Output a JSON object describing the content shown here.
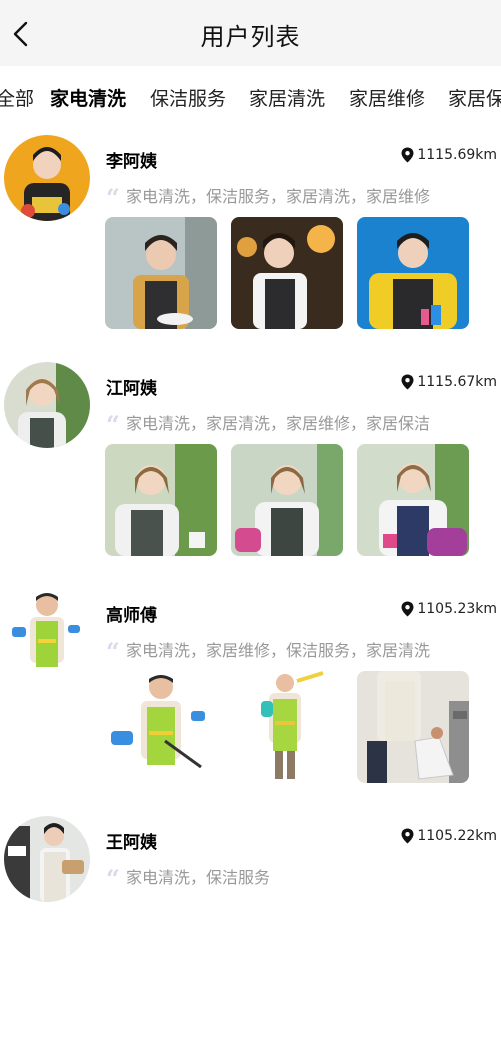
{
  "header": {
    "title": "用户列表",
    "back_icon": "chevron-left-icon"
  },
  "tabs": [
    {
      "label": "全部",
      "active": false
    },
    {
      "label": "家电清洗",
      "active": true
    },
    {
      "label": "保洁服务",
      "active": false
    },
    {
      "label": "家居清洗",
      "active": false
    },
    {
      "label": "家居维修",
      "active": false
    },
    {
      "label": "家居保洁",
      "active": false
    }
  ],
  "workers": [
    {
      "name": "李阿姨",
      "distance": "1115.69km",
      "services": "家电清洗，保洁服务，家居清洗，家居维修"
    },
    {
      "name": "江阿姨",
      "distance": "1115.67km",
      "services": "家电清洗，家居清洗，家居维修，家居保洁"
    },
    {
      "name": "高师傅",
      "distance": "1105.23km",
      "services": "家电清洗，家居维修，保洁服务，家居清洗"
    },
    {
      "name": "王阿姨",
      "distance": "1105.22km",
      "services": "家电清洗，保洁服务"
    }
  ],
  "colors": {
    "accent_quote": "#d8dbe8",
    "muted_text": "#999999",
    "header_bg": "#f5f5f5"
  }
}
